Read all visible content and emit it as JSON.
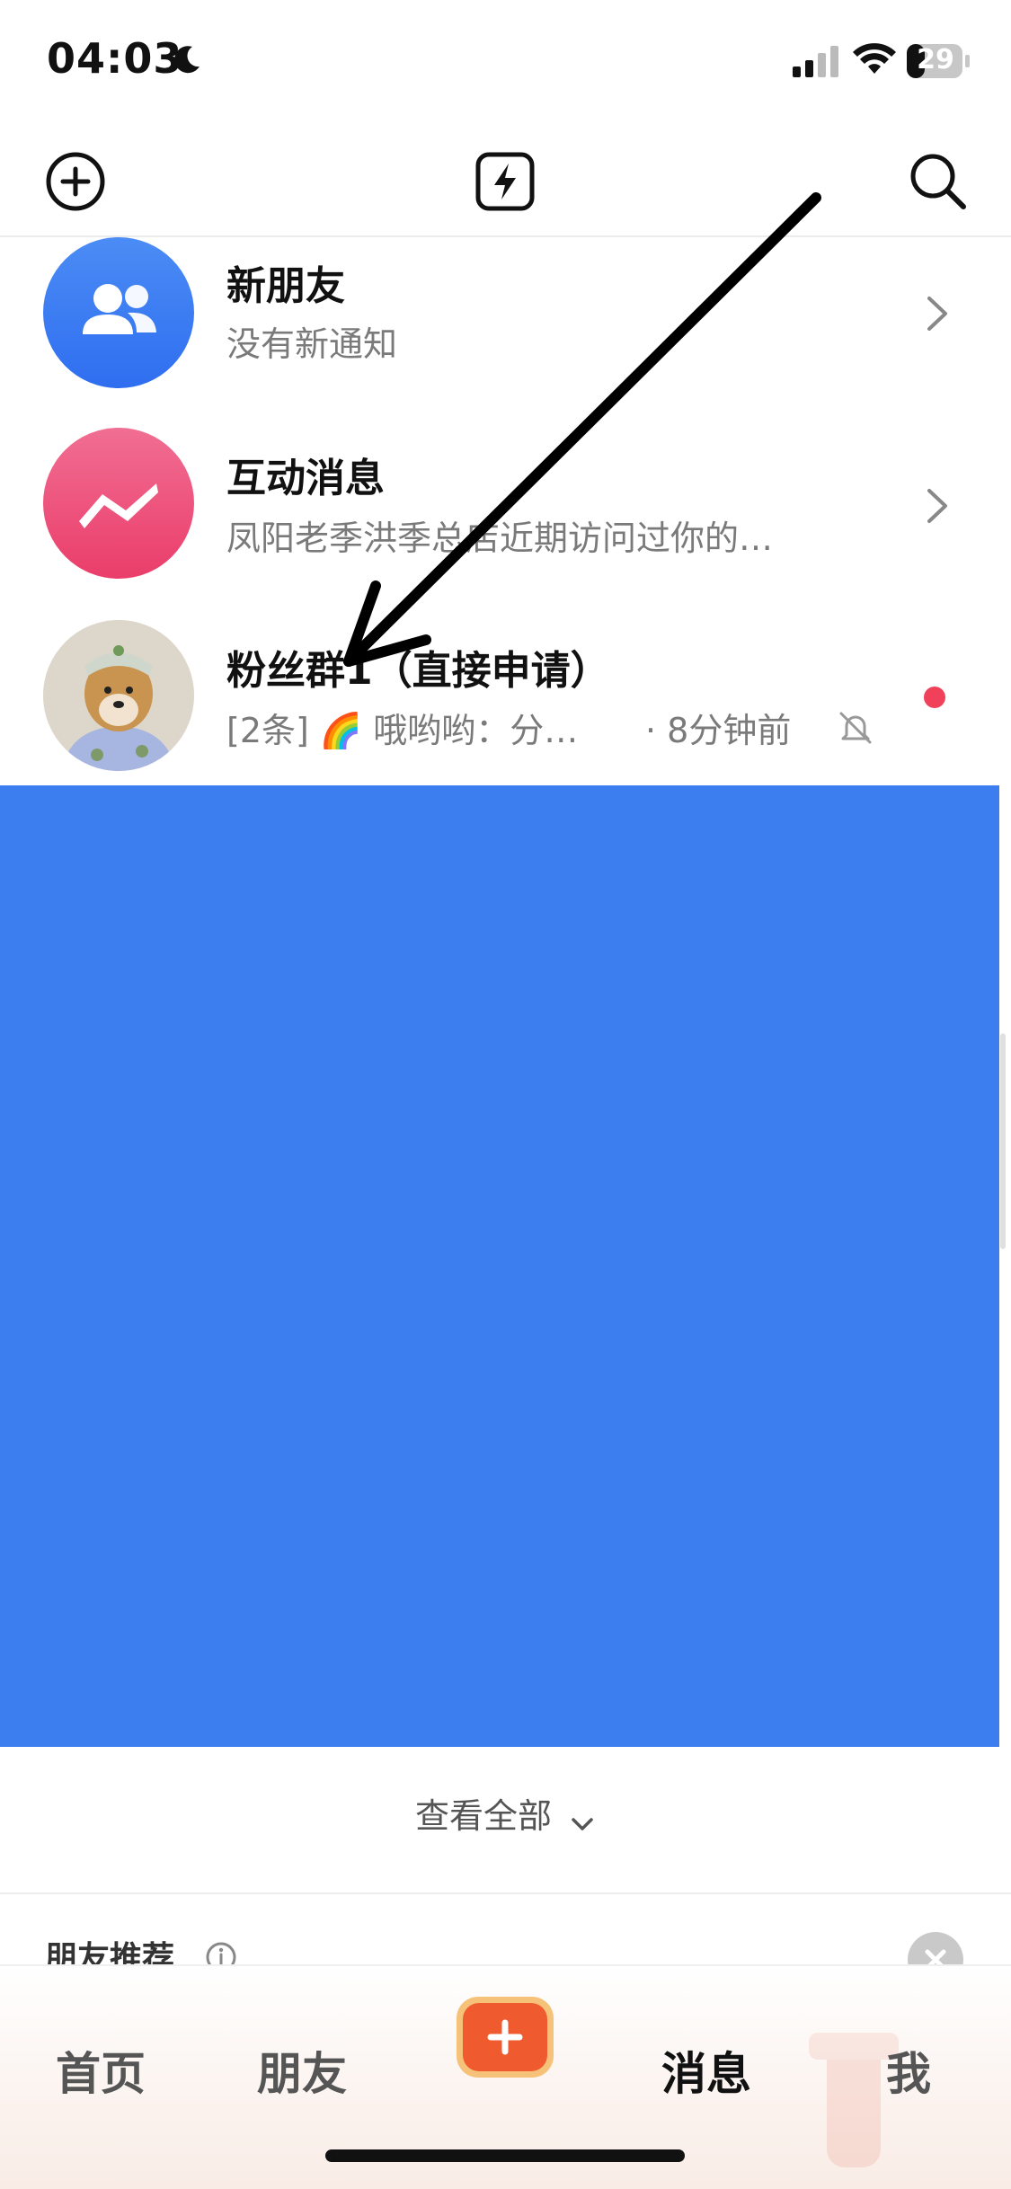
{
  "status_bar": {
    "time": "04:03",
    "battery": "29"
  },
  "header": {
    "add_icon": "plus-circle-icon",
    "flash_icon": "lightning-icon",
    "search_icon": "search-icon"
  },
  "messages": [
    {
      "title": "新朋友",
      "subtitle": "没有新通知",
      "icon": "people-icon",
      "color": "#3a7cf2"
    },
    {
      "title": "互动消息",
      "subtitle": "凤阳老季洪季总店近期访问过你的…",
      "icon": "zigzag-icon",
      "color": "#ef4f7a"
    },
    {
      "title": "粉丝群1（直接申请）",
      "subtitle": "[2条] 🌈 哦哟哟：分…",
      "time": "· 8分钟前",
      "icon": "dog-avatar",
      "unread": true,
      "muted": true
    }
  ],
  "view_all": {
    "label": "查看全部"
  },
  "friends_recommend": {
    "label": "朋友推荐"
  },
  "tabs": {
    "home": "首页",
    "friends": "朋友",
    "messages": "消息",
    "me": "我"
  }
}
